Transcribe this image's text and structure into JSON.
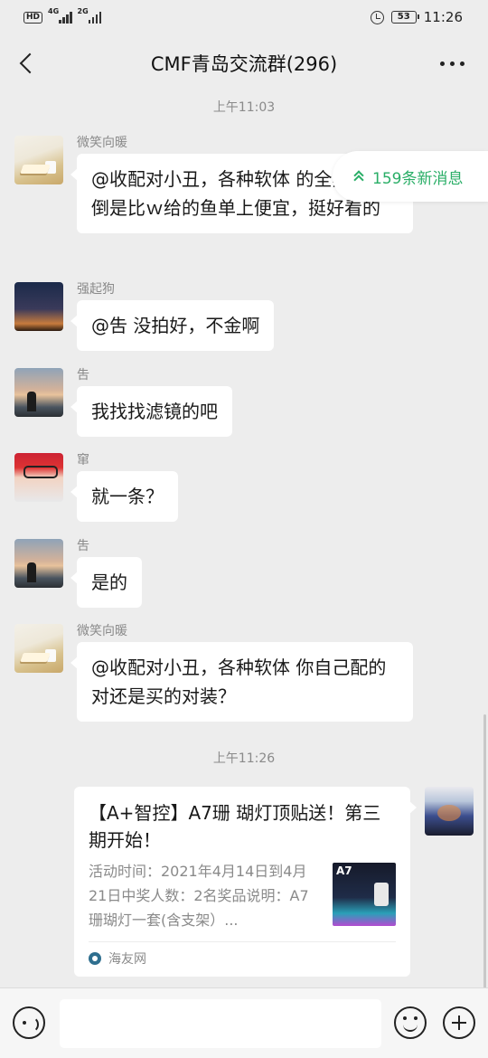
{
  "status_bar": {
    "hd_label": "HD",
    "signal1_label": "4G",
    "signal2_label": "2G",
    "battery": "53",
    "time": "11:26"
  },
  "header": {
    "title": "CMF青岛交流群(296)"
  },
  "new_messages": {
    "label": "159条新消息"
  },
  "timestamps": [
    "上午11:03",
    "上午11:26"
  ],
  "messages": [
    {
      "sender": "微笑向暖",
      "text": "@收配对小丑，各种软体  的全黑背心倒是比ｗ给的鱼单上便宜，挺好看的",
      "avatar": "book-photo"
    },
    {
      "sender": "强起狗",
      "text": "@吿  没拍好，不金啊",
      "avatar": "night-sky-photo"
    },
    {
      "sender": "吿",
      "text": "我找找滤镜的吧",
      "avatar": "sunset-person-photo"
    },
    {
      "sender": "窜",
      "text": "就一条？",
      "avatar": "red-hat-person-photo"
    },
    {
      "sender": "吿",
      "text": "是的",
      "avatar": "sunset-person-photo"
    },
    {
      "sender": "微笑向暖",
      "text": "@收配对小丑，各种软体  你自己配的对还是买的对装？",
      "avatar": "book-photo"
    }
  ],
  "link_card": {
    "title": "【A+智控】A7珊 瑚灯顶贴送！第三期开始！",
    "description": "活动时间：2021年4月14日到4月21日中奖人数：2名奖品说明：A7珊瑚灯一套(含支架）...",
    "thumb_label": "A7",
    "source": "海友网"
  },
  "input_bar": {
    "placeholder": ""
  },
  "colors": {
    "accent_green": "#2aae67",
    "background": "#ededed",
    "bubble": "#ffffff"
  }
}
